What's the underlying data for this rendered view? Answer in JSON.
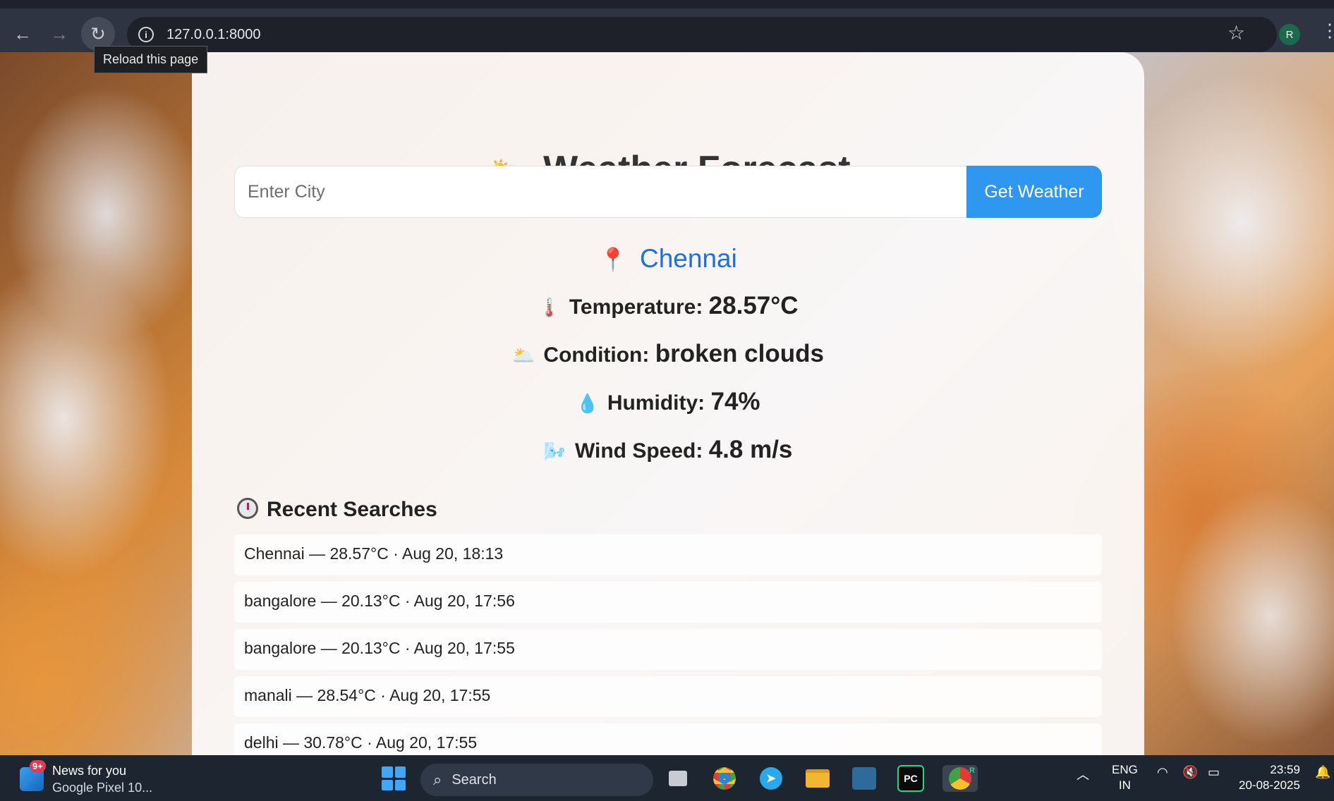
{
  "browser": {
    "url": "127.0.0.1:8000",
    "tooltip": "Reload this page",
    "profile_initial": "R"
  },
  "app": {
    "title": "Weather Forecast",
    "title_icon": "🌥️",
    "search": {
      "placeholder": "Enter City",
      "button_label": "Get Weather"
    },
    "current": {
      "city": "Chennai",
      "city_icon": "📍",
      "temperature_label": "Temperature:",
      "temperature_value": "28.57°C",
      "temperature_icon": "🌡️",
      "condition_label": "Condition:",
      "condition_value": "broken clouds",
      "condition_icon": "🌥️",
      "humidity_label": "Humidity:",
      "humidity_value": "74%",
      "humidity_icon": "💧",
      "wind_label": "Wind Speed:",
      "wind_value": "4.8 m/s",
      "wind_icon": "🌬️"
    },
    "recent": {
      "heading": "Recent Searches",
      "items": [
        "Chennai — 28.57°C · Aug 20, 18:13",
        "bangalore — 20.13°C · Aug 20, 17:56",
        "bangalore — 20.13°C · Aug 20, 17:55",
        "manali — 28.54°C · Aug 20, 17:55",
        "delhi — 30.78°C · Aug 20, 17:55"
      ]
    }
  },
  "taskbar": {
    "news_badge": "9+",
    "news_title": "News for you",
    "news_subtitle": "Google Pixel 10...",
    "search_label": "Search",
    "pycharm_label": "PC",
    "chrome_profile": "R",
    "lang_line1": "ENG",
    "lang_line2": "IN",
    "time": "23:59",
    "date": "20-08-2025"
  },
  "colors": {
    "accent_button": "#2f97f0",
    "city_link": "#1f6fe0"
  }
}
